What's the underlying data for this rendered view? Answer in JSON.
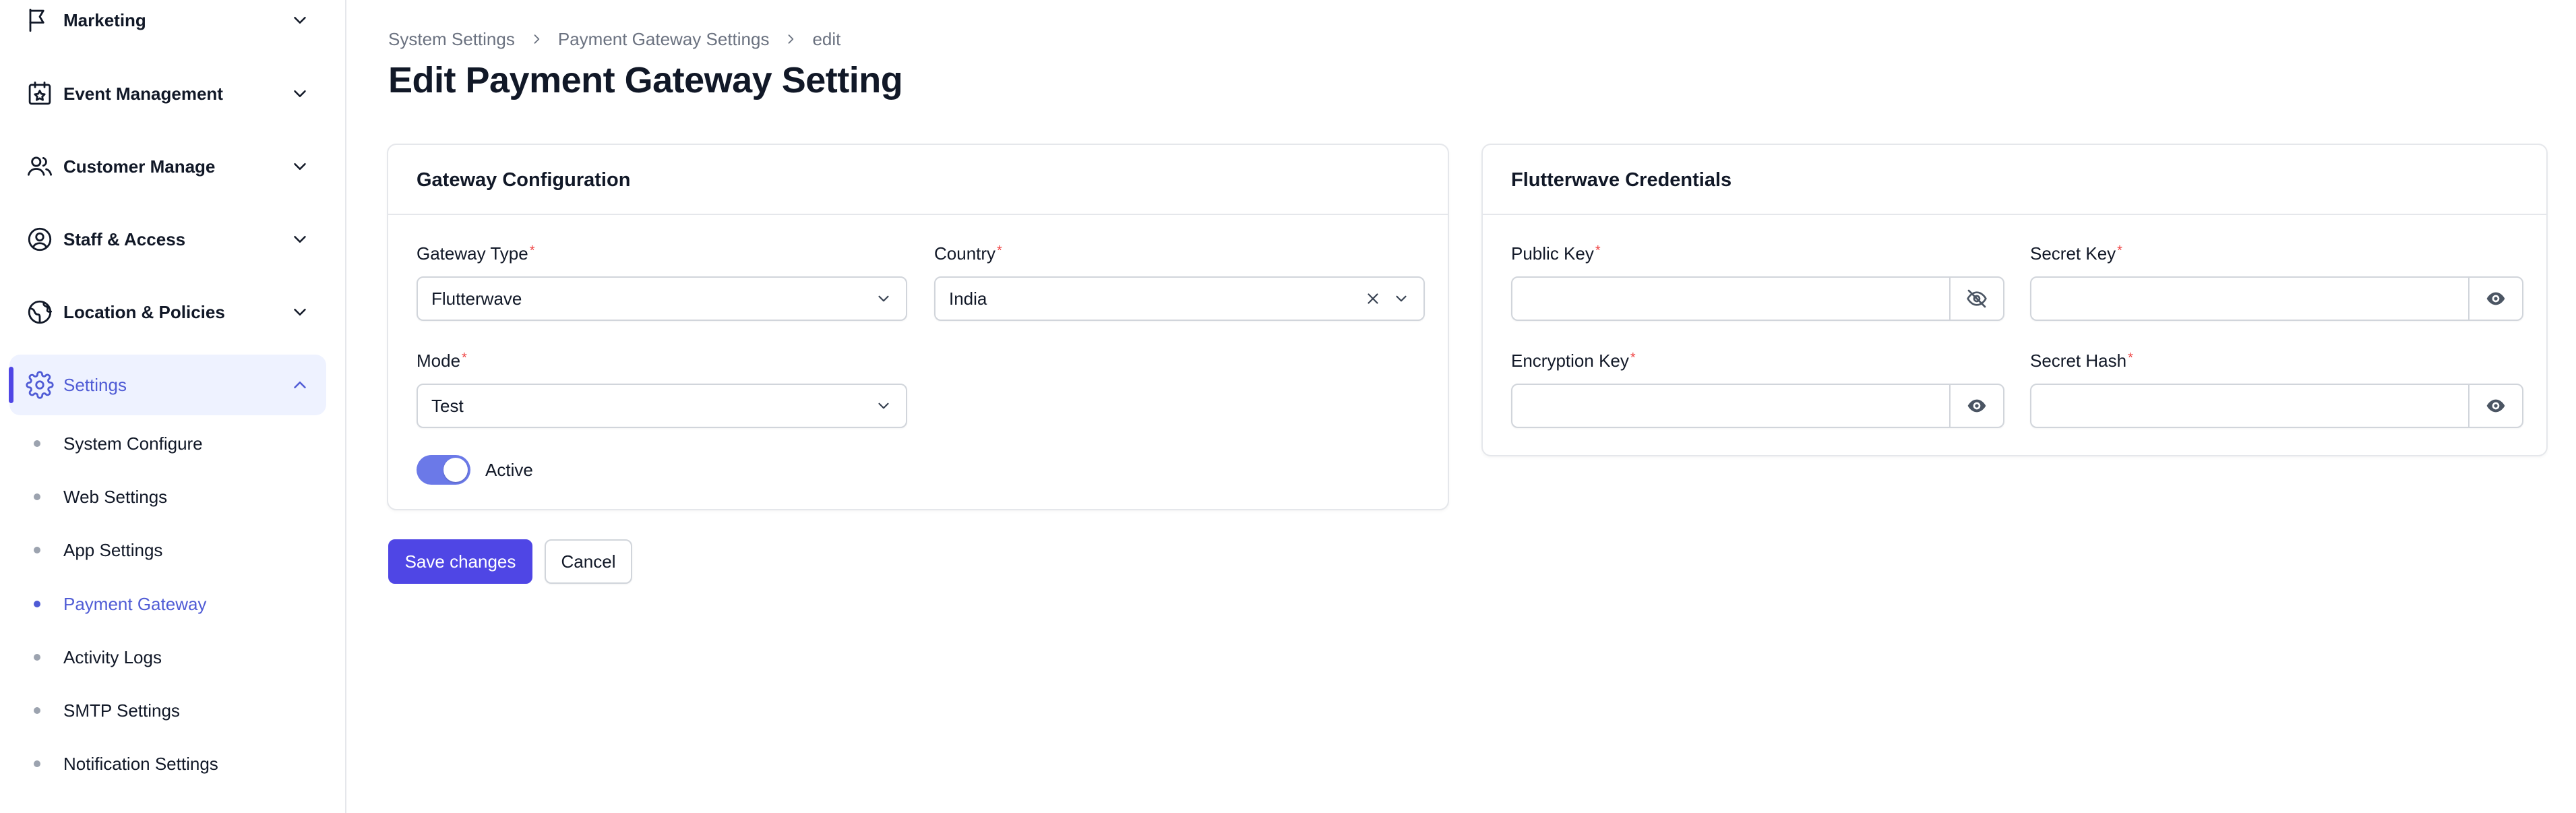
{
  "sidebar": {
    "groups": [
      {
        "label": "Marketing",
        "icon": "megaphone-icon"
      },
      {
        "label": "Event Management",
        "icon": "calendar-star-icon"
      },
      {
        "label": "Customer Manage",
        "icon": "users-icon"
      },
      {
        "label": "Staff & Access",
        "icon": "user-circle-icon"
      },
      {
        "label": "Location & Policies",
        "icon": "globe-icon"
      },
      {
        "label": "Settings",
        "icon": "gear-icon",
        "expanded": true
      }
    ],
    "settings_items": [
      {
        "label": "System Configure"
      },
      {
        "label": "Web Settings"
      },
      {
        "label": "App Settings"
      },
      {
        "label": "Payment Gateway",
        "active": true
      },
      {
        "label": "Activity Logs"
      },
      {
        "label": "SMTP Settings"
      },
      {
        "label": "Notification Settings"
      }
    ]
  },
  "breadcrumb": [
    "System Settings",
    "Payment Gateway Settings",
    "edit"
  ],
  "page_title": "Edit Payment Gateway Setting",
  "gateway_config": {
    "title": "Gateway Configuration",
    "gateway_type": {
      "label": "Gateway Type",
      "value": "Flutterwave"
    },
    "country": {
      "label": "Country",
      "value": "India"
    },
    "mode": {
      "label": "Mode",
      "value": "Test"
    },
    "active": {
      "label": "Active",
      "on": true
    },
    "required_mark": "*"
  },
  "credentials": {
    "title": "Flutterwave Credentials",
    "public_key": {
      "label": "Public Key",
      "value": "",
      "visible": true
    },
    "secret_key": {
      "label": "Secret Key",
      "value": "",
      "visible": false
    },
    "encryption_key": {
      "label": "Encryption Key",
      "value": "",
      "visible": false
    },
    "secret_hash": {
      "label": "Secret Hash",
      "value": "",
      "visible": false
    }
  },
  "actions": {
    "save_label": "Save changes",
    "cancel_label": "Cancel"
  },
  "colors": {
    "accent": "#4f46e5",
    "active_text": "#4f5bd5",
    "active_bg": "#eef2ff",
    "toggle_on": "#6b79e8",
    "required": "#ef4444",
    "border": "#e5e7eb"
  }
}
